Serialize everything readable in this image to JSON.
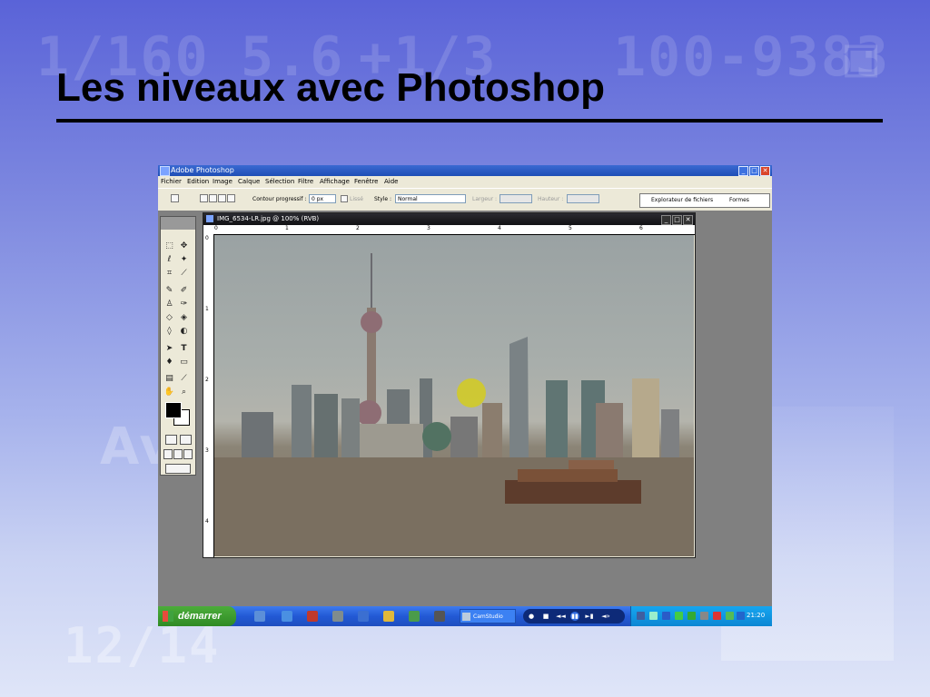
{
  "slide": {
    "title": "Les niveaux avec Photoshop",
    "background_watermarks": [
      "1/160",
      "5.6",
      "+1/3",
      "100-9383",
      "12/14",
      "Av"
    ],
    "accent_colors": {
      "background_top": "#5a63d8",
      "background_bottom": "#dfe5f8",
      "title_color": "#000000"
    }
  },
  "app": {
    "title": "Adobe Photoshop",
    "window_controls": {
      "minimize": "_",
      "maximize": "□",
      "close": "✕"
    },
    "menu": [
      "Fichier",
      "Edition",
      "Image",
      "Calque",
      "Sélection",
      "Filtre",
      "Affichage",
      "Fenêtre",
      "Aide"
    ],
    "options": {
      "feather_label": "Contour progressif :",
      "feather_value": "0 px",
      "antialias_label": "Lissé",
      "style_label": "Style :",
      "style_value": "Normal",
      "width_label": "Largeur :",
      "height_label": "Hauteur :"
    },
    "palette_tabs": [
      "Explorateur de fichiers",
      "Formes"
    ],
    "toolbox": {
      "tools": [
        "marquee",
        "move",
        "lasso",
        "magic-wand",
        "crop",
        "slice",
        "healing-brush",
        "brush",
        "clone-stamp",
        "history-brush",
        "eraser",
        "paint-bucket",
        "blur",
        "dodge",
        "path-selection",
        "type",
        "pen",
        "shape",
        "notes",
        "eyedropper",
        "hand",
        "zoom"
      ],
      "foreground_color": "#000000",
      "background_color": "#ffffff"
    },
    "document": {
      "title": "IMG_6534-LR.jpg @ 100% (RVB)",
      "controls": {
        "minimize": "_",
        "maximize": "□",
        "close": "✕"
      },
      "ruler_h": [
        "0",
        "1",
        "2",
        "3",
        "4",
        "5",
        "6"
      ],
      "ruler_v": [
        "0",
        "1",
        "2",
        "3",
        "4"
      ]
    }
  },
  "taskbar": {
    "start_label": "démarrer",
    "active_task": "CamStudio",
    "media_controls": [
      "●",
      "■",
      "◄◄",
      "▮▮",
      "►▮",
      "◄»"
    ],
    "clock": "21:20"
  }
}
